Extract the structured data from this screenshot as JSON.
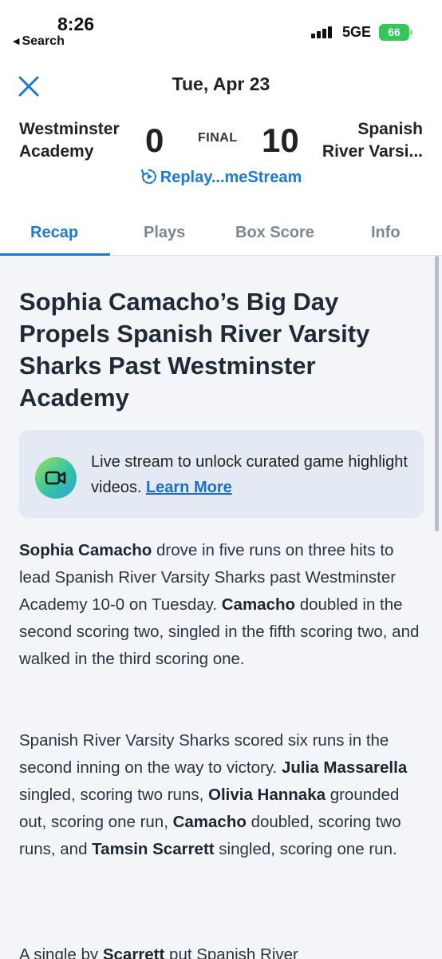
{
  "status_bar": {
    "time": "8:26",
    "back_label": "Search",
    "network": "5GE",
    "battery": "66"
  },
  "header": {
    "date": "Tue, Apr 23",
    "home_team": {
      "line1": "Westminster",
      "line2": "Academy",
      "score": "0"
    },
    "away_team": {
      "line1": "Spanish",
      "line2": "River Varsi...",
      "score": "10"
    },
    "status": "FINAL",
    "replay_label": "Replay...meStream"
  },
  "tabs": [
    {
      "label": "Recap",
      "active": true
    },
    {
      "label": "Plays",
      "active": false
    },
    {
      "label": "Box Score",
      "active": false
    },
    {
      "label": "Info",
      "active": false
    }
  ],
  "article": {
    "headline": "Sophia Camacho’s Big Day Propels Spanish River Varsity Sharks Past Westminster Academy",
    "promo": {
      "text": "Live stream to unlock curated game highlight videos.",
      "link": "Learn More"
    },
    "paragraph1": [
      {
        "text": "Sophia Camacho",
        "bold": true
      },
      {
        "text": " drove in five runs on three hits to lead Spanish River Varsity Sharks past Westminster Academy 10-0 on Tuesday. ",
        "bold": false
      },
      {
        "text": "Camacho",
        "bold": true
      },
      {
        "text": " doubled in the second scoring two, singled in the fifth scoring two, and walked in the third scoring one.",
        "bold": false
      }
    ],
    "paragraph2": [
      {
        "text": "Spanish River Varsity Sharks scored six runs in the second inning on the way to victory. ",
        "bold": false
      },
      {
        "text": "Julia Massarella",
        "bold": true
      },
      {
        "text": " singled, scoring two runs, ",
        "bold": false
      },
      {
        "text": "Olivia Hannaka",
        "bold": true
      },
      {
        "text": " grounded out, scoring one run, ",
        "bold": false
      },
      {
        "text": "Camacho",
        "bold": true
      },
      {
        "text": " doubled, scoring two runs, and ",
        "bold": false
      },
      {
        "text": "Tamsin Scarrett",
        "bold": true
      },
      {
        "text": " singled, scoring one run.",
        "bold": false
      }
    ],
    "paragraph3": [
      {
        "text": "A single by ",
        "bold": false
      },
      {
        "text": "Scarrett",
        "bold": true
      },
      {
        "text": " put Spanish River",
        "bold": false
      }
    ]
  },
  "colors": {
    "accent": "#1b7ad1",
    "background": "#f3f5f9",
    "promo_bg": "#e4eaf4",
    "battery": "#34c759"
  },
  "icons": [
    "chevron-left-icon",
    "signal-icon",
    "battery-icon",
    "close-icon",
    "replay-icon",
    "video-camera-icon"
  ]
}
